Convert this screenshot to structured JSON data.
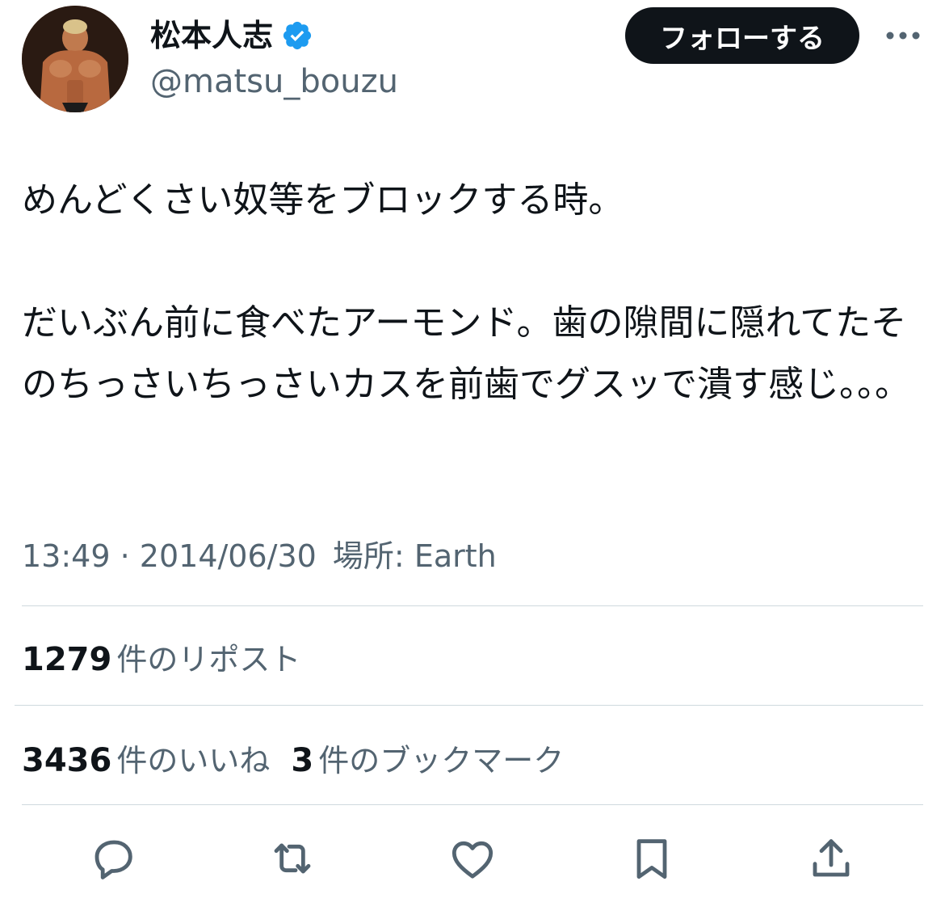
{
  "author": {
    "display_name": "松本人志",
    "handle": "@matsu_bouzu",
    "verified": true,
    "avatar_icon": "avatar"
  },
  "header": {
    "follow_label": "フォローする",
    "more_icon": "more-icon"
  },
  "tweet": {
    "text": "めんどくさい奴等をブロックする時。\n\nだいぶん前に食べたアーモンド。歯の隙間に隠れてたそのちっさいちっさいカスを前歯でグスッで潰す感じ。。。"
  },
  "meta": {
    "time": "13:49",
    "separator": "·",
    "date": "2014/06/30",
    "location_label": "場所:",
    "location": "Earth"
  },
  "stats": {
    "reposts_count": "1279",
    "reposts_label": "件のリポスト",
    "likes_count": "3436",
    "likes_label": "件のいいね",
    "bookmarks_count": "3",
    "bookmarks_label": "件のブックマーク"
  },
  "actions": [
    "reply-icon",
    "repost-icon",
    "like-icon",
    "bookmark-icon",
    "share-icon"
  ],
  "colors": {
    "text_primary": "#0f1419",
    "text_secondary": "#536471",
    "verified_blue": "#1d9bf0",
    "button_bg": "#0f1419",
    "divider": "#cfd9de"
  }
}
